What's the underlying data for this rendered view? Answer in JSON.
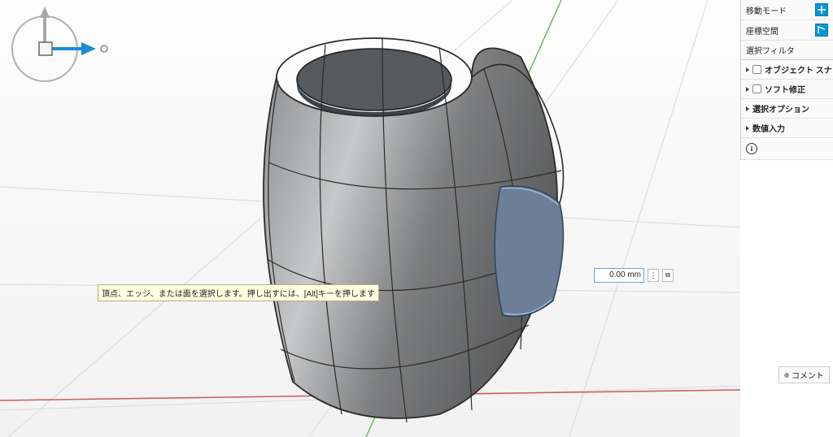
{
  "panel": {
    "move_mode_label": "移動モード",
    "coord_space_label": "座標空間",
    "selection_filter_label": "選択フィルタ",
    "object_snap_label": "オブジェクト スナップ",
    "soft_mod_label": "ソフト修正",
    "select_options_label": "選択オプション",
    "numeric_input_label": "数値入力"
  },
  "hint_text": "頂点、エッジ、または面を選択します。押し出すには、[Alt]キーを押します",
  "dimension_value": "0.00 mm",
  "comment_label": "コメント"
}
